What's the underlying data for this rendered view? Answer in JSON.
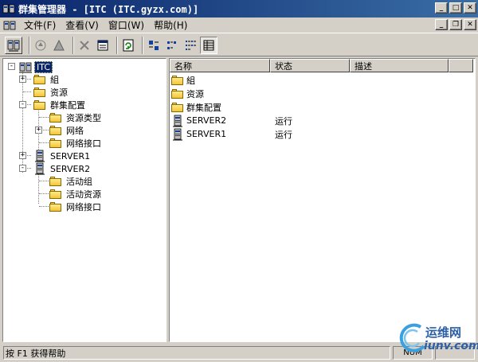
{
  "window": {
    "title": "群集管理器 - [ITC (ITC.gyzx.com)]"
  },
  "menubar": {
    "items": [
      "文件(F)",
      "查看(V)",
      "窗口(W)",
      "帮助(H)"
    ]
  },
  "toolbar": {
    "buttons": [
      "connect-icon",
      "online-icon",
      "offline-icon",
      "delete-icon",
      "properties-icon",
      "refresh-icon",
      "large-icons-icon",
      "small-icons-icon",
      "list-icon",
      "details-icon"
    ]
  },
  "tree": {
    "root": "ITC",
    "items": [
      {
        "label": "組",
        "level": 1,
        "expander": "+"
      },
      {
        "label": "资源",
        "level": 1,
        "expander": ""
      },
      {
        "label": "群集配置",
        "level": 1,
        "expander": "-"
      },
      {
        "label": "资源类型",
        "level": 2,
        "expander": ""
      },
      {
        "label": "网络",
        "level": 2,
        "expander": "+"
      },
      {
        "label": "网络接口",
        "level": 2,
        "expander": ""
      },
      {
        "label": "SERVER1",
        "level": 1,
        "expander": "+"
      },
      {
        "label": "SERVER2",
        "level": 1,
        "expander": "-"
      },
      {
        "label": "活动组",
        "level": 2,
        "expander": ""
      },
      {
        "label": "活动资源",
        "level": 2,
        "expander": ""
      },
      {
        "label": "网络接口",
        "level": 2,
        "expander": ""
      }
    ]
  },
  "list": {
    "columns": [
      "名称",
      "状态",
      "描述"
    ],
    "rows": [
      {
        "name": "組",
        "status": "",
        "icon": "folder"
      },
      {
        "name": "资源",
        "status": "",
        "icon": "folder"
      },
      {
        "name": "群集配置",
        "status": "",
        "icon": "folder"
      },
      {
        "name": "SERVER2",
        "status": "运行",
        "icon": "server"
      },
      {
        "name": "SERVER1",
        "status": "运行",
        "icon": "server"
      }
    ]
  },
  "statusbar": {
    "text": "按 F1 获得帮助",
    "panel": "NUM"
  },
  "watermark": {
    "line1": "运维网",
    "line2": "iunv.com"
  }
}
